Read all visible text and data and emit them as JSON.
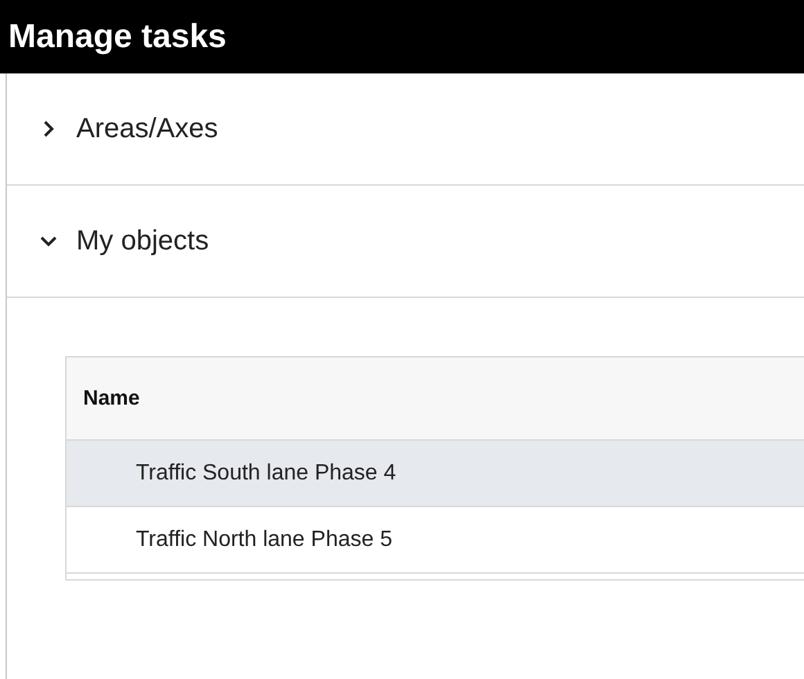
{
  "window": {
    "title": "Manage tasks"
  },
  "sections": [
    {
      "label": "Areas/Axes",
      "expanded": false
    },
    {
      "label": "My objects",
      "expanded": true
    }
  ],
  "table": {
    "columns": [
      "Name"
    ],
    "rows": [
      {
        "name": "Traffic South lane Phase 4",
        "selected": true
      },
      {
        "name": "Traffic North lane Phase 5",
        "selected": false
      }
    ]
  }
}
